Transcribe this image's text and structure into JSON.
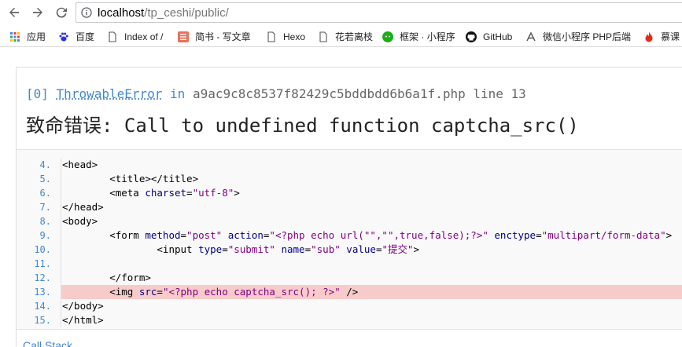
{
  "browser": {
    "url_host": "localhost",
    "url_path": "/tp_ceshi/public/"
  },
  "bookmarks": [
    {
      "label": "应用",
      "icon": "apps-grid-icon"
    },
    {
      "label": "百度",
      "icon": "baidu-paw-icon"
    },
    {
      "label": "Index of /",
      "icon": "page-icon"
    },
    {
      "label": "简书 - 写文章",
      "icon": "jianshu-icon"
    },
    {
      "label": "Hexo",
      "icon": "page-icon"
    },
    {
      "label": "花若离枝",
      "icon": "page-icon"
    },
    {
      "label": "框架 · 小程序",
      "icon": "wechat-icon"
    },
    {
      "label": "GitHub",
      "icon": "github-icon"
    },
    {
      "label": "微信小程序 PHP后端",
      "icon": "wechat-dev-icon"
    },
    {
      "label": "慕课",
      "icon": "flame-icon"
    }
  ],
  "exception": {
    "index": "[0]",
    "class": "ThrowableError",
    "in_word": "in",
    "file": "a9ac9c8c8537f82429c5bddbdd6b6a1f.php",
    "line_word": "line",
    "line": "13",
    "message": "致命错误: Call to undefined function captcha_src()"
  },
  "source_lines": [
    {
      "no": "4.",
      "text": "<head>"
    },
    {
      "no": "5.",
      "text": "        <title></title>"
    },
    {
      "no": "6.",
      "text": "        <meta charset=\"utf-8\">"
    },
    {
      "no": "7.",
      "text": "</head>"
    },
    {
      "no": "8.",
      "text": "<body>"
    },
    {
      "no": "9.",
      "text": "        <form method=\"post\" action=\"<?php echo url(\"\",\"\",true,false);?>\" enctype=\"multipart/form-data\">"
    },
    {
      "no": "10.",
      "text": "                <input type=\"submit\" name=\"sub\" value=\"提交\">"
    },
    {
      "no": "11.",
      "text": ""
    },
    {
      "no": "12.",
      "text": "        </form>"
    },
    {
      "no": "13.",
      "text": "        <img src=\"<?php echo captcha_src(); ?>\" />",
      "highlight": true
    },
    {
      "no": "14.",
      "text": "</body>"
    },
    {
      "no": "15.",
      "text": "</html>"
    }
  ],
  "callstack_label": "Call Stack",
  "colors": {
    "link": "#4288ce",
    "highlight": "#f8cbcb"
  }
}
